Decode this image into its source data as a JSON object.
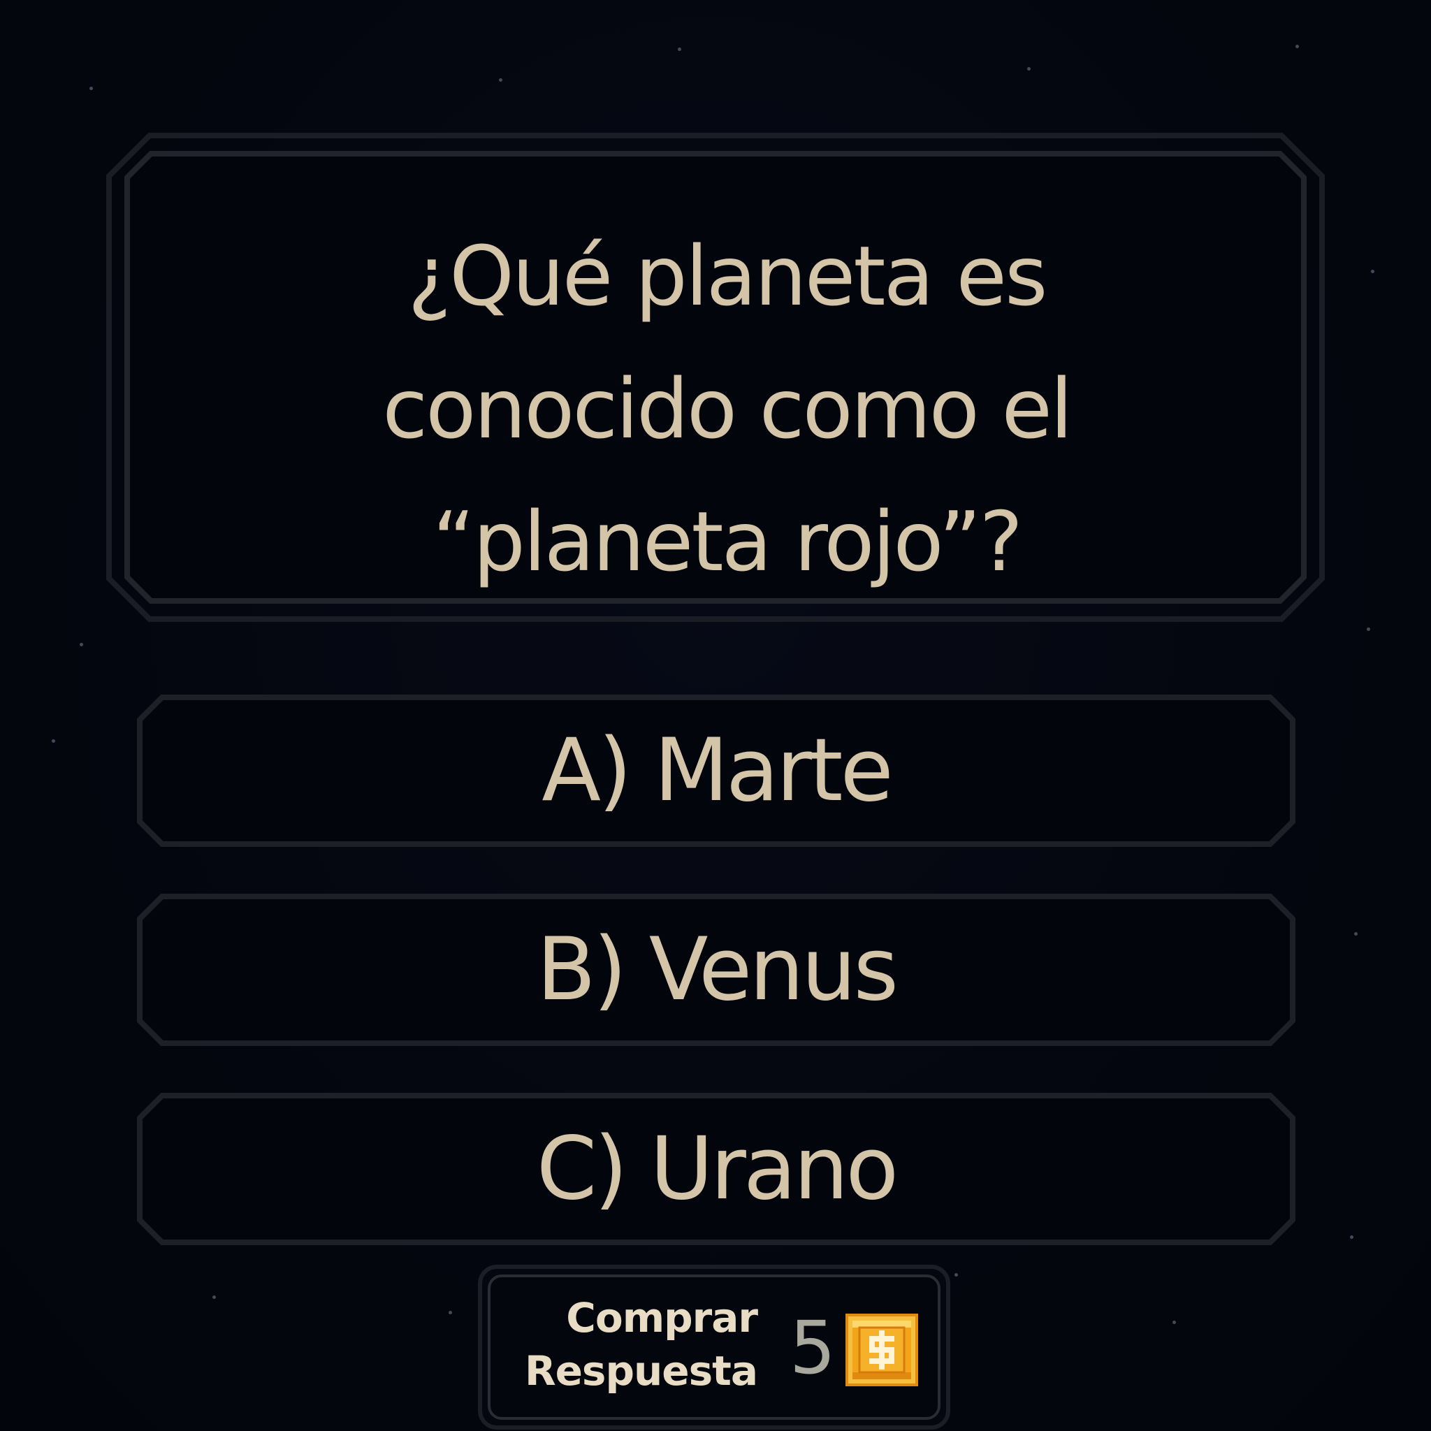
{
  "question": {
    "text": "¿Qué planeta es\nconocido como el\n“planeta rojo”?"
  },
  "answers": [
    {
      "label": "A) Marte"
    },
    {
      "label": "B) Venus"
    },
    {
      "label": "C) Urano"
    }
  ],
  "buy_answer": {
    "label_line1": "Comprar",
    "label_line2": "Respuesta",
    "price": "5",
    "currency_icon": "coin-icon"
  },
  "colors": {
    "background": "#04060f",
    "text": "#d4c4a8",
    "frame_stroke": "#1e1f28",
    "coin": "#f2a51a"
  }
}
